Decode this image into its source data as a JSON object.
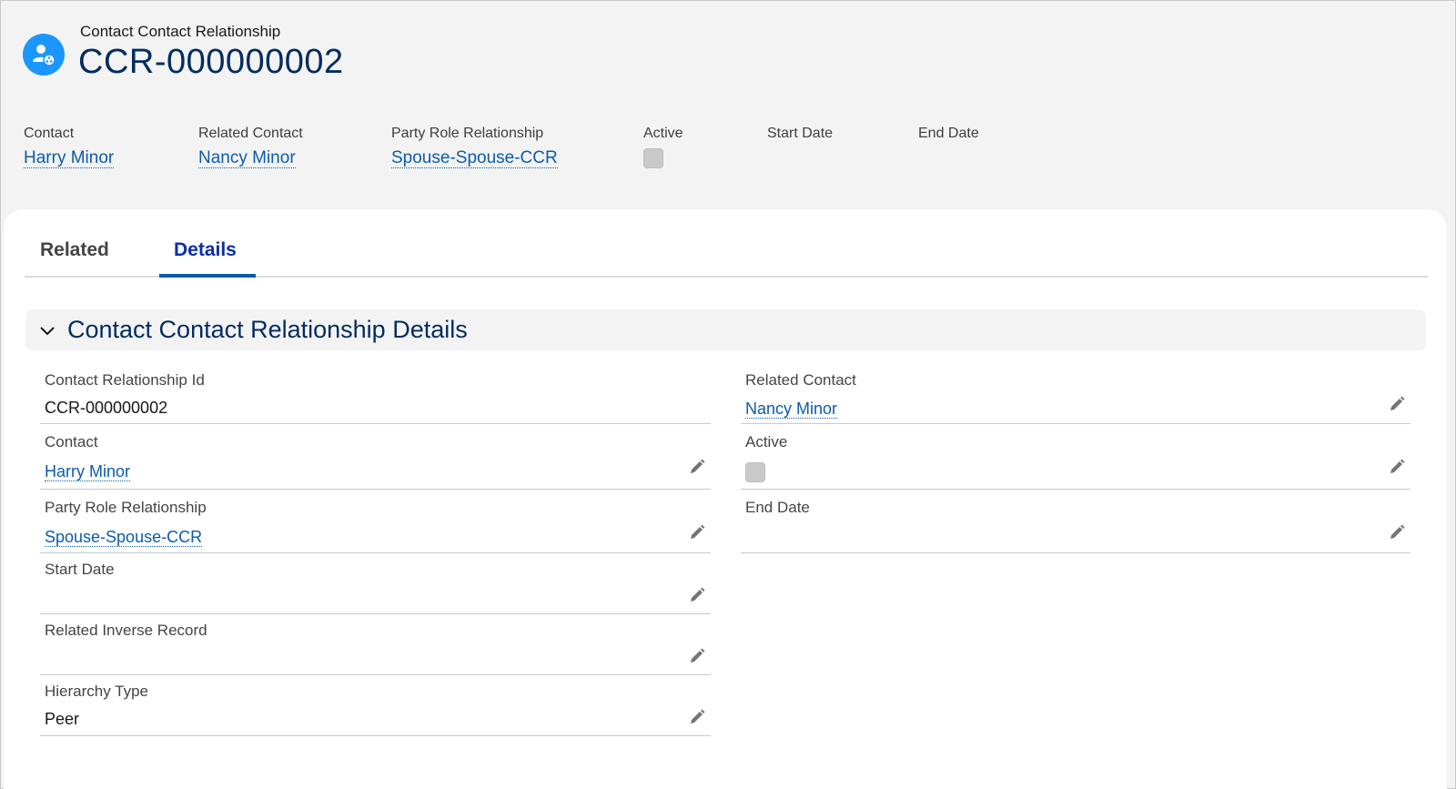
{
  "header": {
    "object_label": "Contact Contact Relationship",
    "record_name": "CCR-000000002",
    "icon": "contact-relationship-icon"
  },
  "highlights": [
    {
      "label": "Contact",
      "value": "Harry Minor",
      "type": "link"
    },
    {
      "label": "Related Contact",
      "value": "Nancy Minor",
      "type": "link"
    },
    {
      "label": "Party Role Relationship",
      "value": "Spouse-Spouse-CCR",
      "type": "link"
    },
    {
      "label": "Active",
      "value": false,
      "type": "checkbox"
    },
    {
      "label": "Start Date",
      "value": "",
      "type": "text"
    },
    {
      "label": "End Date",
      "value": "",
      "type": "text"
    }
  ],
  "tabs": [
    {
      "label": "Related",
      "active": false
    },
    {
      "label": "Details",
      "active": true
    }
  ],
  "section": {
    "title": "Contact Contact Relationship Details",
    "expanded": true
  },
  "fields_left": [
    {
      "label": "Contact Relationship Id",
      "value": "CCR-000000002",
      "type": "text",
      "editable": false
    },
    {
      "label": "Contact",
      "value": "Harry Minor",
      "type": "link",
      "editable": true
    },
    {
      "label": "Party Role Relationship",
      "value": "Spouse-Spouse-CCR",
      "type": "link",
      "editable": true
    },
    {
      "label": "Start Date",
      "value": "",
      "type": "text",
      "editable": true
    },
    {
      "label": "Related Inverse Record",
      "value": "",
      "type": "text",
      "editable": true
    },
    {
      "label": "Hierarchy Type",
      "value": "Peer",
      "type": "text",
      "editable": true
    }
  ],
  "fields_right": [
    {
      "label": "Related Contact",
      "value": "Nancy Minor",
      "type": "link",
      "editable": true
    },
    {
      "label": "Active",
      "value": false,
      "type": "checkbox",
      "editable": true
    },
    {
      "label": "End Date",
      "value": "",
      "type": "text",
      "editable": true
    }
  ],
  "colors": {
    "brand_blue": "#1b96ff",
    "link": "#0b5cab",
    "title": "#032d60",
    "active_tab": "#0b2ea8",
    "page_bg": "#f3f3f3"
  }
}
